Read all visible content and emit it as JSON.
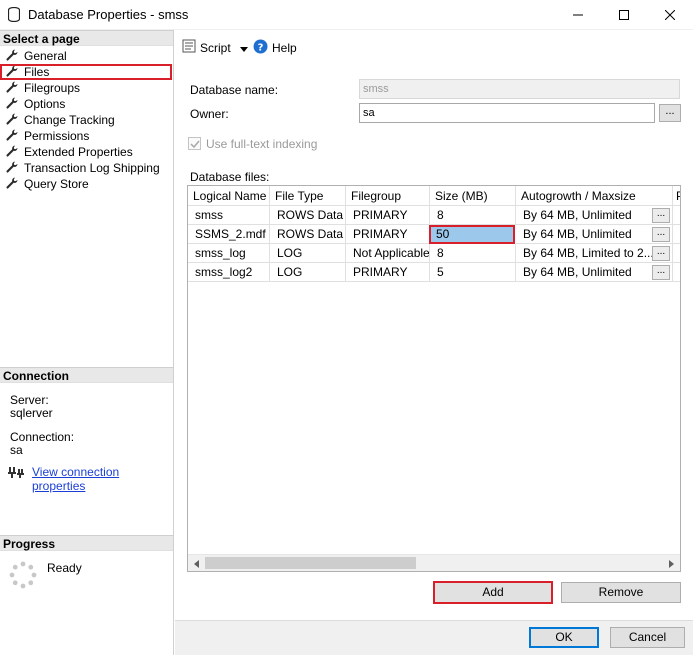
{
  "window": {
    "title": "Database Properties - smss",
    "icon": "database-icon"
  },
  "left_pane": {
    "select_page_header": "Select a page",
    "pages": [
      {
        "label": "General"
      },
      {
        "label": "Files"
      },
      {
        "label": "Filegroups"
      },
      {
        "label": "Options"
      },
      {
        "label": "Change Tracking"
      },
      {
        "label": "Permissions"
      },
      {
        "label": "Extended Properties"
      },
      {
        "label": "Transaction Log Shipping"
      },
      {
        "label": "Query Store"
      }
    ],
    "selected_page": "Files",
    "connection_header": "Connection",
    "server_label": "Server:",
    "server_value": "sqlerver",
    "connection_label": "Connection:",
    "connection_value": "sa",
    "view_connection_link": "View connection properties",
    "progress_header": "Progress",
    "progress_status": "Ready"
  },
  "toolbar": {
    "script_label": "Script",
    "help_label": "Help"
  },
  "form": {
    "database_name_label": "Database name:",
    "database_name_value": "smss",
    "owner_label": "Owner:",
    "owner_value": "sa",
    "owner_browse": "...",
    "fulltext_label": "Use full-text indexing",
    "fulltext_checked": true,
    "database_files_label": "Database files:"
  },
  "grid": {
    "columns": [
      "Logical Name",
      "File Type",
      "Filegroup",
      "Size (MB)",
      "Autogrowth / Maxsize",
      "P"
    ],
    "rows": [
      {
        "logical_name": "smss",
        "file_type": "ROWS Data",
        "filegroup": "PRIMARY",
        "size": "8",
        "autogrowth": "By 64 MB, Unlimited",
        "btn": "..."
      },
      {
        "logical_name": "SSMS_2.mdf",
        "file_type": "ROWS Data",
        "filegroup": "PRIMARY",
        "size": "50",
        "autogrowth": "By 64 MB, Unlimited",
        "btn": "..."
      },
      {
        "logical_name": "smss_log",
        "file_type": "LOG",
        "filegroup": "Not Applicable",
        "size": "8",
        "autogrowth": "By 64 MB, Limited to 2...",
        "btn": "..."
      },
      {
        "logical_name": "smss_log2",
        "file_type": "LOG",
        "filegroup": "PRIMARY",
        "size": "5",
        "autogrowth": "By 64 MB, Unlimited",
        "btn": "..."
      }
    ]
  },
  "buttons": {
    "add": "Add",
    "remove": "Remove",
    "ok": "OK",
    "cancel": "Cancel"
  },
  "colors": {
    "highlight_red": "#d9202a",
    "editing_cell": "#9cc8eb",
    "link_blue": "#1a3fd6",
    "primary_border": "#0078d7"
  }
}
